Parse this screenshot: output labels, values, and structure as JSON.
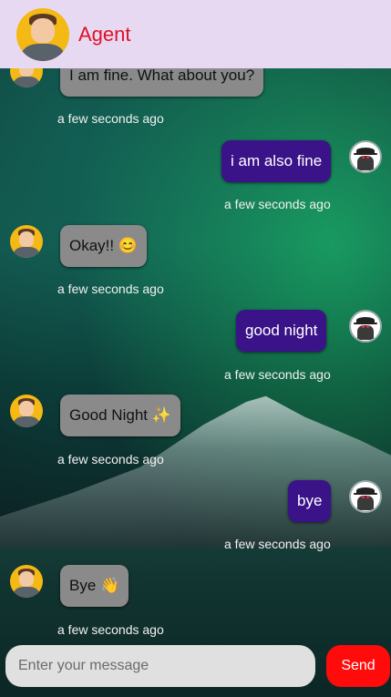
{
  "header": {
    "title": "Agent",
    "avatar": "agent-avatar"
  },
  "messages": [
    {
      "from": "agent",
      "text": "I am fine. What about you?",
      "time": "a few seconds ago"
    },
    {
      "from": "user",
      "text": "i am also fine",
      "time": "a few seconds ago"
    },
    {
      "from": "agent",
      "text": "Okay!! 😊",
      "time": "a few seconds ago"
    },
    {
      "from": "user",
      "text": "good night",
      "time": "a few seconds ago"
    },
    {
      "from": "agent",
      "text": "Good Night ✨",
      "time": "a few seconds ago"
    },
    {
      "from": "user",
      "text": "bye",
      "time": "a few seconds ago"
    },
    {
      "from": "agent",
      "text": "Bye 👋",
      "time": "a few seconds ago"
    }
  ],
  "composer": {
    "placeholder": "Enter your message",
    "send_label": "Send"
  },
  "colors": {
    "header_bg": "#e7d9f1",
    "title": "#e0102b",
    "agent_bubble": "#8a8a8a",
    "user_bubble": "#3a1388",
    "send_button": "#ff0b0b"
  }
}
